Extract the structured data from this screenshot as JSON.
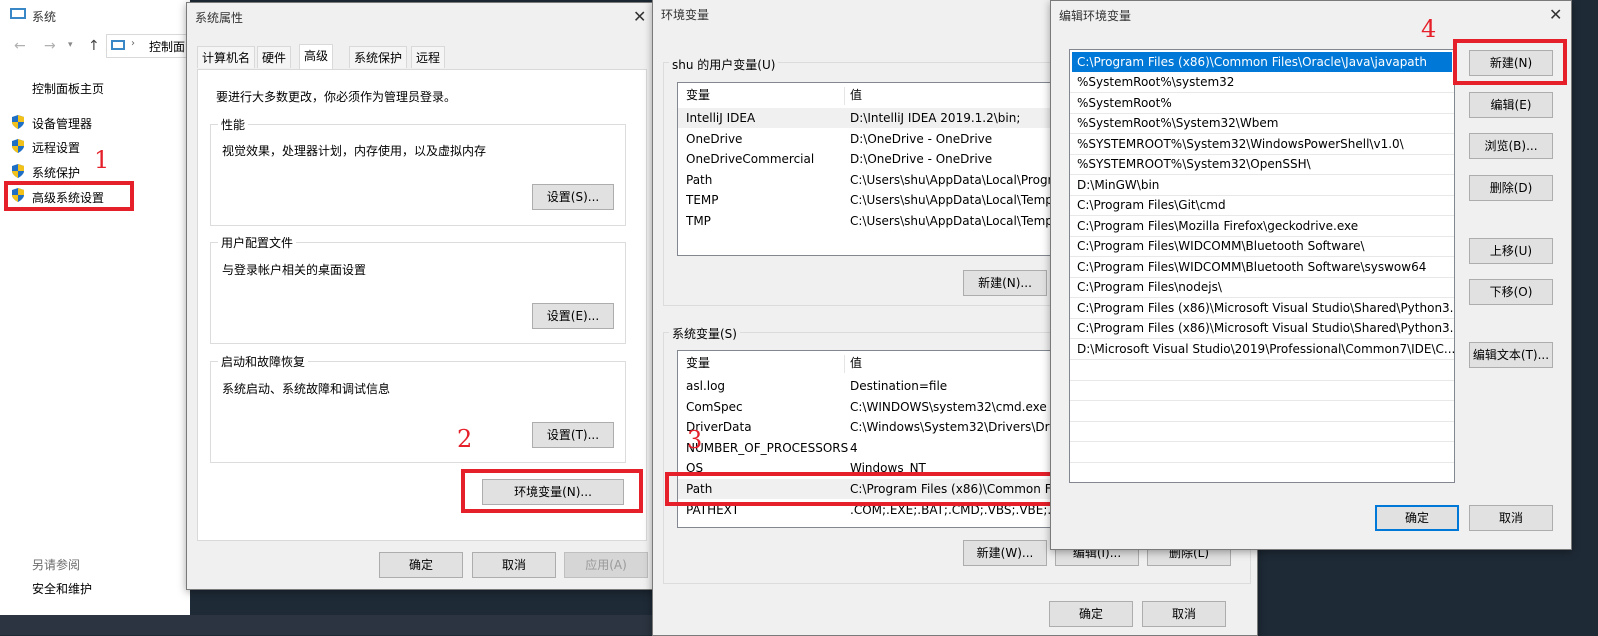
{
  "control_panel": {
    "title": "系统",
    "address": "控制面",
    "home": "控制面板主页",
    "links": [
      "设备管理器",
      "远程设置",
      "系统保护",
      "高级系统设置"
    ],
    "see_also": "另请参阅",
    "security": "安全和维护"
  },
  "sysprops": {
    "title": "系统属性",
    "tabs": [
      "计算机名",
      "硬件",
      "高级",
      "系统保护",
      "远程"
    ],
    "admin_note": "要进行大多数更改，你必须作为管理员登录。",
    "perf_title": "性能",
    "perf_desc": "视觉效果，处理器计划，内存使用，以及虚拟内存",
    "perf_btn": "设置(S)...",
    "profile_title": "用户配置文件",
    "profile_desc": "与登录帐户相关的桌面设置",
    "profile_btn": "设置(E)...",
    "startup_title": "启动和故障恢复",
    "startup_desc": "系统启动、系统故障和调试信息",
    "startup_btn": "设置(T)...",
    "env_btn": "环境变量(N)...",
    "ok": "确定",
    "cancel": "取消",
    "apply": "应用(A)"
  },
  "envvars": {
    "title": "环境变量",
    "user_group": "shu 的用户变量(U)",
    "col_var": "变量",
    "col_val": "值",
    "user_rows": [
      {
        "name": "IntelliJ IDEA",
        "value": "D:\\IntelliJ IDEA 2019.1.2\\bin;"
      },
      {
        "name": "OneDrive",
        "value": "D:\\OneDrive - OneDrive"
      },
      {
        "name": "OneDriveCommercial",
        "value": "D:\\OneDrive - OneDrive"
      },
      {
        "name": "Path",
        "value": "C:\\Users\\shu\\AppData\\Local\\Progra"
      },
      {
        "name": "TEMP",
        "value": "C:\\Users\\shu\\AppData\\Local\\Temp"
      },
      {
        "name": "TMP",
        "value": "C:\\Users\\shu\\AppData\\Local\\Temp"
      }
    ],
    "user_new": "新建(N)...",
    "sys_group": "系统变量(S)",
    "sys_rows": [
      {
        "name": "asl.log",
        "value": "Destination=file"
      },
      {
        "name": "ComSpec",
        "value": "C:\\WINDOWS\\system32\\cmd.exe"
      },
      {
        "name": "DriverData",
        "value": "C:\\Windows\\System32\\Drivers\\Drive"
      },
      {
        "name": "NUMBER_OF_PROCESSORS",
        "value": "4"
      },
      {
        "name": "OS",
        "value": "Windows_NT"
      },
      {
        "name": "Path",
        "value": "C:\\Program Files (x86)\\Common Fi"
      },
      {
        "name": "PATHEXT",
        "value": ".COM;.EXE;.BAT;.CMD;.VBS;.VBE;.JS;"
      }
    ],
    "sys_new": "新建(W)...",
    "sys_edit": "编辑(I)...",
    "sys_delete": "删除(L)",
    "ok": "确定",
    "cancel": "取消"
  },
  "editenv": {
    "title": "编辑环境变量",
    "paths": [
      "C:\\Program Files (x86)\\Common Files\\Oracle\\Java\\javapath",
      "%SystemRoot%\\system32",
      "%SystemRoot%",
      "%SystemRoot%\\System32\\Wbem",
      "%SYSTEMROOT%\\System32\\WindowsPowerShell\\v1.0\\",
      "%SYSTEMROOT%\\System32\\OpenSSH\\",
      "D:\\MinGW\\bin",
      "C:\\Program Files\\Git\\cmd",
      "C:\\Program Files\\Mozilla Firefox\\geckodrive.exe",
      "C:\\Program Files\\WIDCOMM\\Bluetooth Software\\",
      "C:\\Program Files\\WIDCOMM\\Bluetooth Software\\syswow64",
      "C:\\Program Files\\nodejs\\",
      "C:\\Program Files (x86)\\Microsoft Visual Studio\\Shared\\Python3...",
      "C:\\Program Files (x86)\\Microsoft Visual Studio\\Shared\\Python3...",
      "D:\\Microsoft Visual Studio\\2019\\Professional\\Common7\\IDE\\C..."
    ],
    "new": "新建(N)",
    "edit": "编辑(E)",
    "browse": "浏览(B)...",
    "delete": "删除(D)",
    "up": "上移(U)",
    "down": "下移(O)",
    "edit_text": "编辑文本(T)...",
    "ok": "确定",
    "cancel": "取消"
  },
  "annotations": [
    "1",
    "2",
    "3",
    "4"
  ],
  "colors": {
    "accent": "#0078d7",
    "annotation_red": "#e5202a",
    "selection": "#0078d7"
  }
}
